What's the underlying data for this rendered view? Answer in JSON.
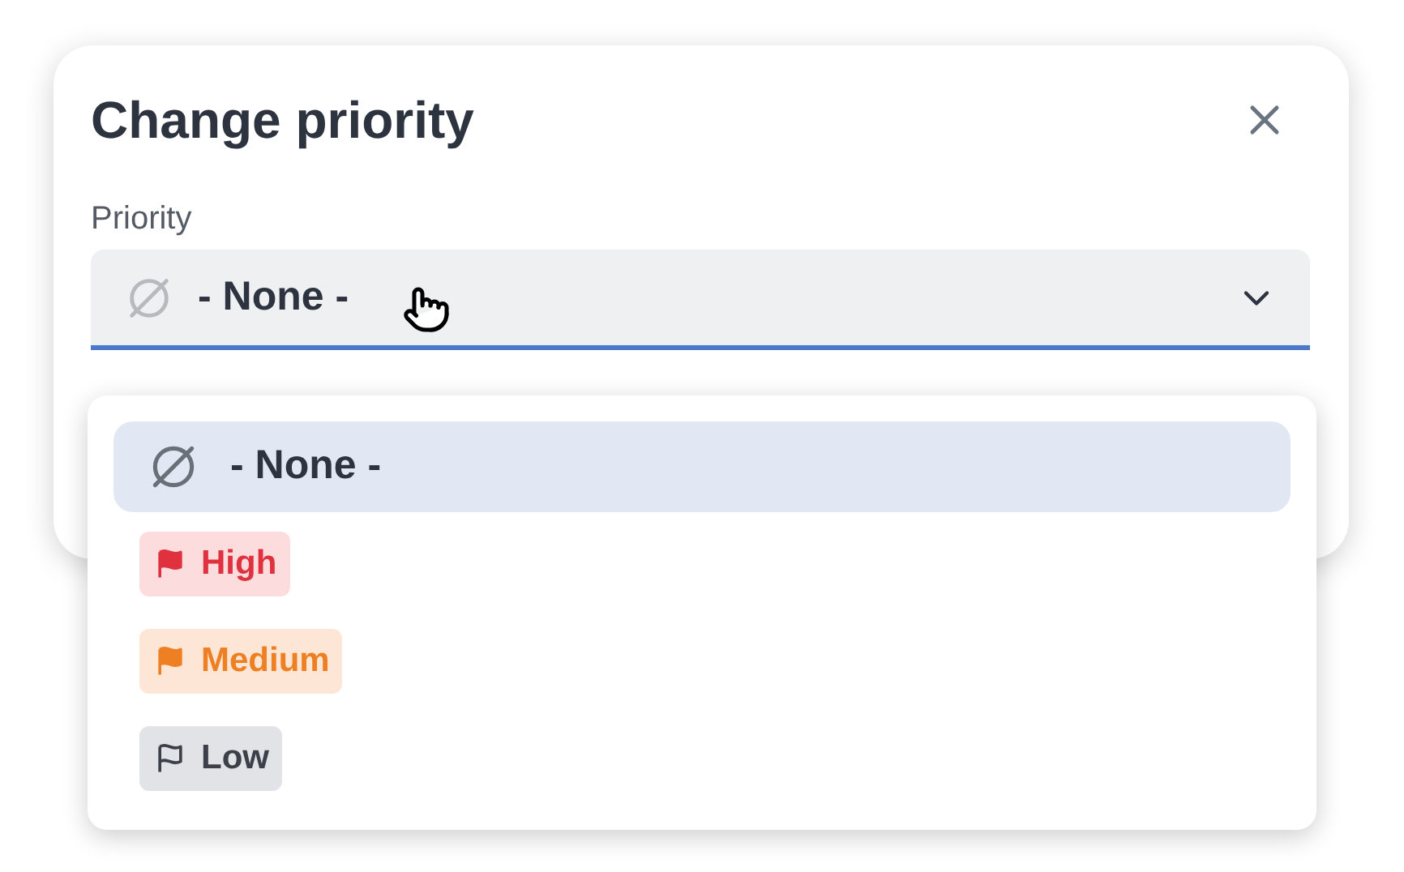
{
  "dialog": {
    "title": "Change priority",
    "field": {
      "label": "Priority",
      "value": "- None -",
      "expanded": true
    },
    "options": [
      {
        "kind": "none",
        "label": "- None -",
        "selected": true
      },
      {
        "kind": "flag",
        "label": "High",
        "selected": false,
        "color": "#e0313f",
        "filled": true
      },
      {
        "kind": "flag",
        "label": "Medium",
        "selected": false,
        "color": "#ee7f22",
        "filled": true
      },
      {
        "kind": "flag",
        "label": "Low",
        "selected": false,
        "color": "#3b4049",
        "filled": false
      }
    ]
  }
}
